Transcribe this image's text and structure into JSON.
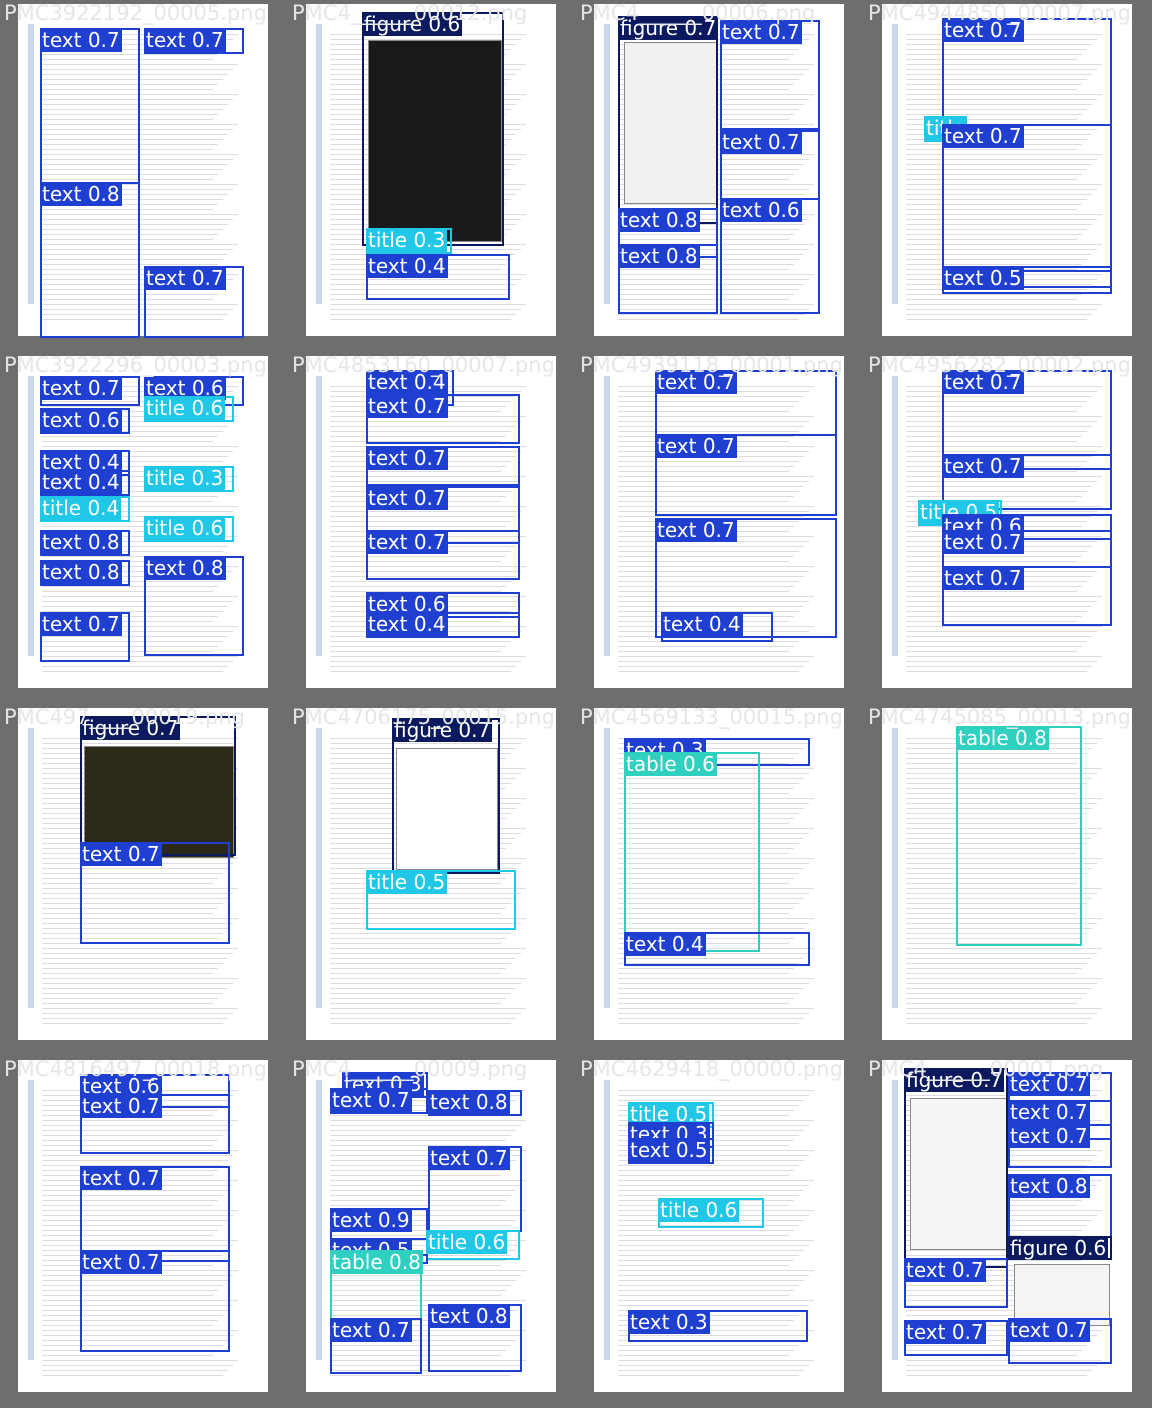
{
  "colors": {
    "text": "#1f3fd1",
    "title": "#21c7e6",
    "figure": "#0b1a5e",
    "table": "#2fd0c0",
    "background": "#6e6e6e",
    "page": "#ffffff"
  },
  "tiles": [
    {
      "file": "PMC3922192_00005.png",
      "boxes": [
        {
          "cls": "text",
          "label": "text 0.7"
        },
        {
          "cls": "text",
          "label": "text 0.7"
        },
        {
          "cls": "text",
          "label": "text 0.8"
        },
        {
          "cls": "text",
          "label": "text 0.7"
        }
      ]
    },
    {
      "file": "PMC4______00012.png",
      "boxes": [
        {
          "cls": "figure",
          "label": "figure 0.6"
        },
        {
          "cls": "title",
          "label": "title 0.3"
        },
        {
          "cls": "text",
          "label": "text 0.4"
        }
      ]
    },
    {
      "file": "PMC4______00006.png",
      "boxes": [
        {
          "cls": "figure",
          "label": "figure 0.7"
        },
        {
          "cls": "text",
          "label": "text 0.7"
        },
        {
          "cls": "text",
          "label": "text 0.7"
        },
        {
          "cls": "text",
          "label": "text 0.6"
        },
        {
          "cls": "text",
          "label": "text 0.8"
        },
        {
          "cls": "text",
          "label": "text 0.8"
        }
      ]
    },
    {
      "file": "PMC4944850_00007.png",
      "boxes": [
        {
          "cls": "text",
          "label": "text 0.7"
        },
        {
          "cls": "title",
          "label": "title"
        },
        {
          "cls": "text",
          "label": "text 0.7"
        },
        {
          "cls": "text",
          "label": "text 0.5"
        }
      ]
    },
    {
      "file": "PMC3922296_00003.png",
      "boxes": [
        {
          "cls": "text",
          "label": "text 0.7"
        },
        {
          "cls": "text",
          "label": "text 0.6"
        },
        {
          "cls": "title",
          "label": "title 0.6"
        },
        {
          "cls": "text",
          "label": "text 0.6"
        },
        {
          "cls": "text",
          "label": "text 0.4"
        },
        {
          "cls": "text",
          "label": "text 0.4"
        },
        {
          "cls": "title",
          "label": "title 0.3"
        },
        {
          "cls": "title",
          "label": "title 0.4"
        },
        {
          "cls": "title",
          "label": "title 0.6"
        },
        {
          "cls": "text",
          "label": "text 0.8"
        },
        {
          "cls": "text",
          "label": "text 0.8"
        },
        {
          "cls": "text",
          "label": "text 0.8"
        },
        {
          "cls": "text",
          "label": "text 0.7"
        }
      ]
    },
    {
      "file": "PMC4853160_00007.png",
      "boxes": [
        {
          "cls": "text",
          "label": "text 0.4"
        },
        {
          "cls": "text",
          "label": "text 0.7"
        },
        {
          "cls": "text",
          "label": "text 0.7"
        },
        {
          "cls": "text",
          "label": "text 0.7"
        },
        {
          "cls": "text",
          "label": "text 0.7"
        },
        {
          "cls": "text",
          "label": "text 0.6"
        },
        {
          "cls": "text",
          "label": "text 0.4"
        }
      ]
    },
    {
      "file": "PMC4939118_00001.png",
      "boxes": [
        {
          "cls": "text",
          "label": "text 0.7"
        },
        {
          "cls": "text",
          "label": "text 0.7"
        },
        {
          "cls": "text",
          "label": "text 0.7"
        },
        {
          "cls": "text",
          "label": "text 0.4"
        }
      ]
    },
    {
      "file": "PMC4956282_00002.png",
      "boxes": [
        {
          "cls": "text",
          "label": "text 0.7"
        },
        {
          "cls": "text",
          "label": "text 0.7"
        },
        {
          "cls": "title",
          "label": "title 0.5"
        },
        {
          "cls": "text",
          "label": "text 0.6"
        },
        {
          "cls": "text",
          "label": "text 0.7"
        },
        {
          "cls": "text",
          "label": "text 0.7"
        }
      ]
    },
    {
      "file": "PMC497____00019.png",
      "boxes": [
        {
          "cls": "figure",
          "label": "figure 0.7"
        },
        {
          "cls": "text",
          "label": "text 0.7"
        }
      ]
    },
    {
      "file": "PMC4706175_00015.png",
      "boxes": [
        {
          "cls": "figure",
          "label": "figure 0.7"
        },
        {
          "cls": "title",
          "label": "title 0.5"
        }
      ]
    },
    {
      "file": "PMC4569133_00015.png",
      "boxes": [
        {
          "cls": "text",
          "label": "text 0.3"
        },
        {
          "cls": "table",
          "label": "table 0.6"
        },
        {
          "cls": "text",
          "label": "text 0.4"
        }
      ]
    },
    {
      "file": "PMC4745085_00013.png",
      "boxes": [
        {
          "cls": "table",
          "label": "table 0.8"
        }
      ]
    },
    {
      "file": "PMC4816497_00018.png",
      "boxes": [
        {
          "cls": "text",
          "label": "text 0.6"
        },
        {
          "cls": "text",
          "label": "text 0.7"
        },
        {
          "cls": "text",
          "label": "text 0.7"
        },
        {
          "cls": "text",
          "label": "text 0.7"
        }
      ]
    },
    {
      "file": "PMC4______00009.png",
      "boxes": [
        {
          "cls": "text",
          "label": "text 0.3"
        },
        {
          "cls": "text",
          "label": "text 0.7"
        },
        {
          "cls": "text",
          "label": "text 0.8"
        },
        {
          "cls": "text",
          "label": "text 0.7"
        },
        {
          "cls": "text",
          "label": "text 0.9"
        },
        {
          "cls": "title",
          "label": "title 0.6"
        },
        {
          "cls": "text",
          "label": "text 0.5"
        },
        {
          "cls": "table",
          "label": "table 0.8"
        },
        {
          "cls": "text",
          "label": "text 0.7"
        },
        {
          "cls": "text",
          "label": "text 0.8"
        }
      ]
    },
    {
      "file": "PMC4629418_00000.png",
      "boxes": [
        {
          "cls": "title",
          "label": "title 0.5"
        },
        {
          "cls": "text",
          "label": "text 0.3"
        },
        {
          "cls": "text",
          "label": "text 0.5"
        },
        {
          "cls": "title",
          "label": "title 0.6"
        },
        {
          "cls": "text",
          "label": "text 0.3"
        }
      ]
    },
    {
      "file": "PMC4______00001.png",
      "boxes": [
        {
          "cls": "figure",
          "label": "figure 0.7"
        },
        {
          "cls": "text",
          "label": "text 0.7"
        },
        {
          "cls": "text",
          "label": "text 0.7"
        },
        {
          "cls": "text",
          "label": "text 0.7"
        },
        {
          "cls": "text",
          "label": "text 0.8"
        },
        {
          "cls": "figure",
          "label": "figure 0.6"
        },
        {
          "cls": "text",
          "label": "text 0.7"
        },
        {
          "cls": "text",
          "label": "text 0.7"
        },
        {
          "cls": "text",
          "label": "text 0.7"
        }
      ]
    }
  ]
}
